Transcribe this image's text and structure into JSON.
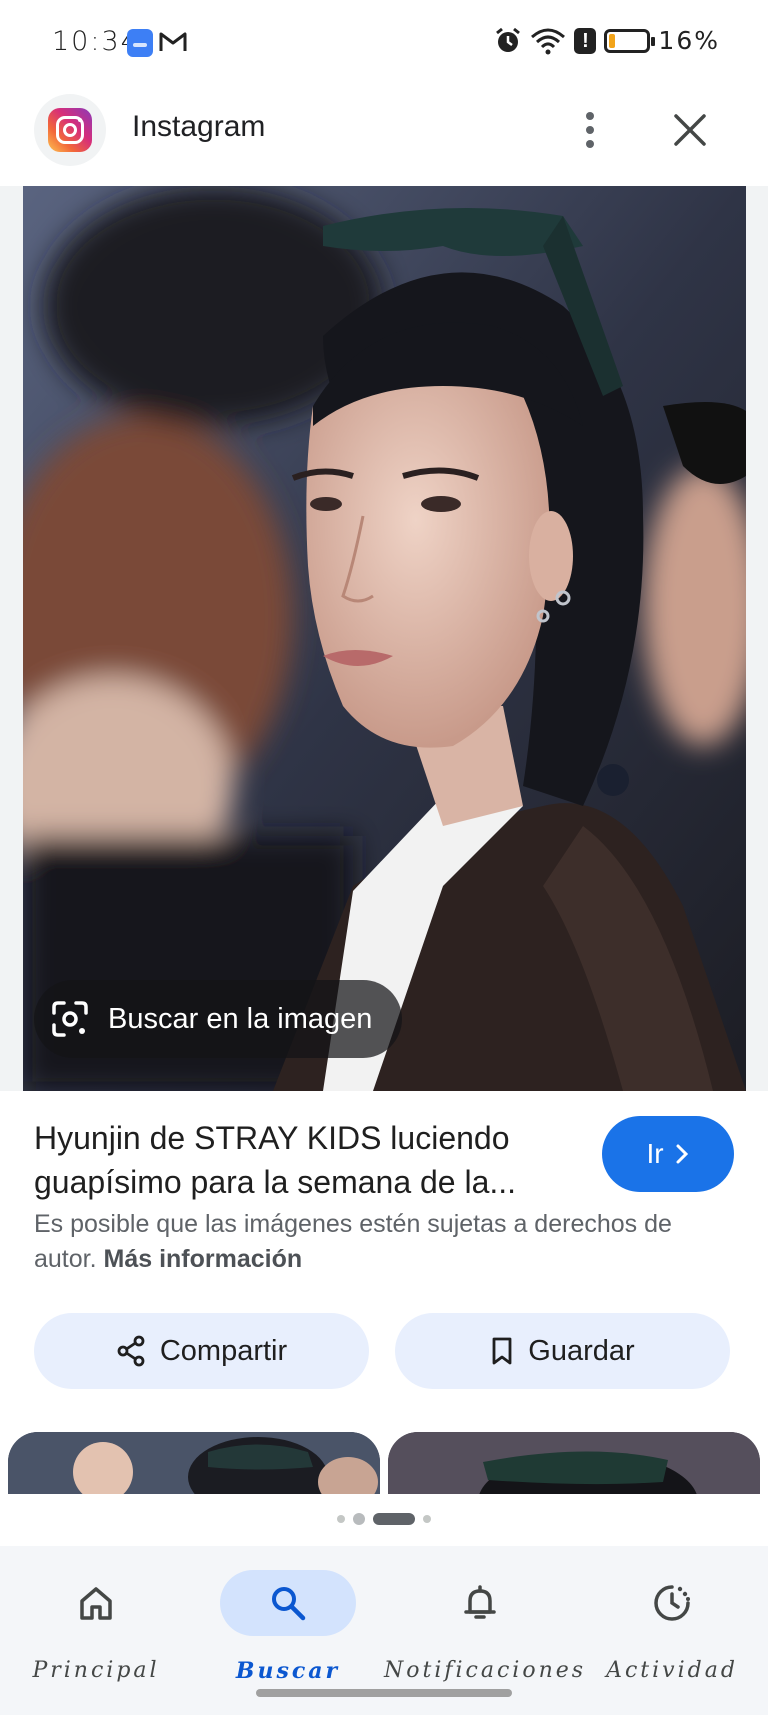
{
  "status_bar": {
    "time": "10:34",
    "battery_percent": "16%",
    "battery_level": 0.16,
    "icons": [
      "app-notification-icon",
      "gmail-icon",
      "alarm-icon",
      "wifi-icon",
      "alert-icon",
      "battery-icon"
    ]
  },
  "header": {
    "source_name": "Instagram",
    "more_icon": "more-vert-icon",
    "close_icon": "close-icon"
  },
  "image": {
    "lens_label": "Buscar en la imagen",
    "lens_icon": "google-lens-icon"
  },
  "result": {
    "title": "Hyunjin de STRAY KIDS luciendo guapísimo para la semana de la...",
    "go_label": "Ir",
    "copyright_text": "Es posible que las imágenes estén sujetas a derechos de autor.",
    "more_info_link": "Más información"
  },
  "actions": {
    "share_label": "Compartir",
    "save_label": "Guardar"
  },
  "bottom_nav": {
    "items": [
      {
        "label": "Principal",
        "icon": "home-icon",
        "active": false
      },
      {
        "label": "Buscar",
        "icon": "search-icon",
        "active": true
      },
      {
        "label": "Notificaciones",
        "icon": "bell-icon",
        "active": false
      },
      {
        "label": "Actividad",
        "icon": "activity-icon",
        "active": false
      }
    ]
  },
  "colors": {
    "accent": "#1a73e8",
    "chip_background": "#e8effd",
    "nav_active_pill": "#d3e3fd",
    "nav_active_text": "#0b57d0",
    "battery_fill": "#f2a41a"
  }
}
